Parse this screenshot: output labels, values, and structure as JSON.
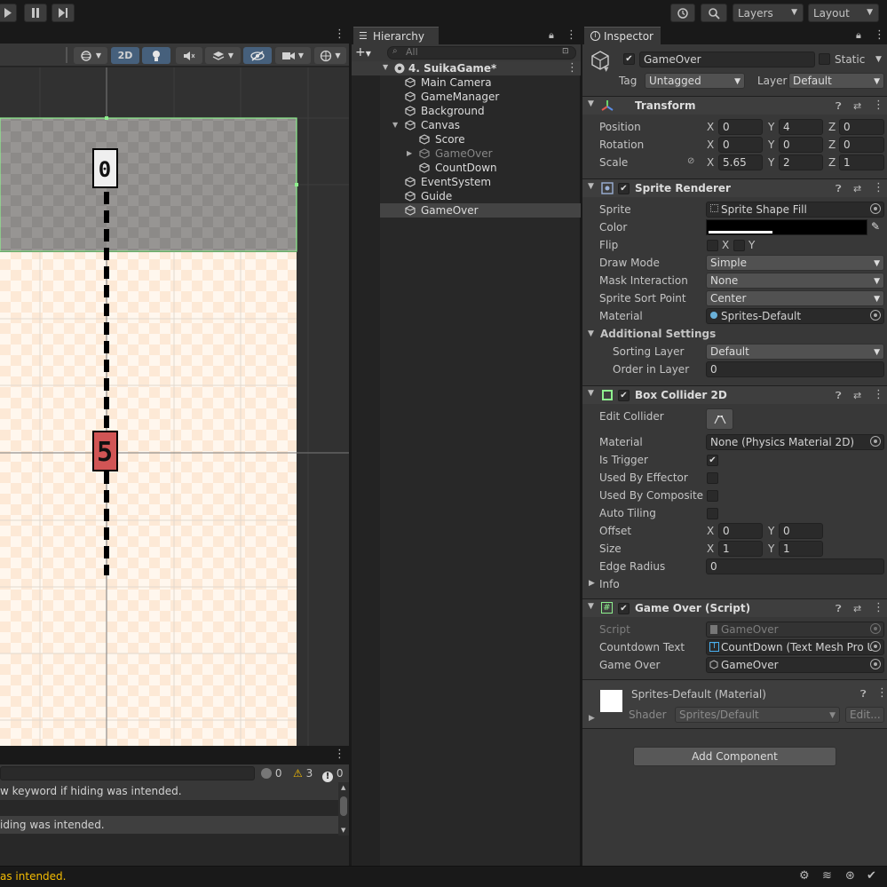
{
  "toolbar": {
    "play_icon": "play-icon",
    "pause_icon": "pause-icon",
    "step_icon": "step-icon",
    "history_icon": "history-icon",
    "search_icon": "search-icon",
    "layers_label": "Layers",
    "layout_label": "Layout"
  },
  "scene": {
    "mode_2d": "2D",
    "digit_top": "0",
    "digit_mid": "5"
  },
  "console": {
    "count_info": "0",
    "count_warn": "3",
    "count_error": "0",
    "line1": "w keyword if hiding was intended.",
    "line2": "iding was intended."
  },
  "hierarchy": {
    "tab_label": "Hierarchy",
    "search_placeholder": "All",
    "scene_name": "4. SuikaGame*",
    "items": [
      {
        "label": "Main Camera"
      },
      {
        "label": "GameManager"
      },
      {
        "label": "Background"
      },
      {
        "label": "Canvas"
      },
      {
        "label": "Score"
      },
      {
        "label": "GameOver"
      },
      {
        "label": "CountDown"
      },
      {
        "label": "EventSystem"
      },
      {
        "label": "Guide"
      },
      {
        "label": "GameOver"
      }
    ]
  },
  "inspector": {
    "tab_label": "Inspector",
    "object_name": "GameOver",
    "static_label": "Static",
    "tag_label": "Tag",
    "tag_value": "Untagged",
    "layer_label": "Layer",
    "layer_value": "Default",
    "transform": {
      "title": "Transform",
      "position_label": "Position",
      "rotation_label": "Rotation",
      "scale_label": "Scale",
      "px": "0",
      "py": "4",
      "pz": "0",
      "rx": "0",
      "ry": "0",
      "rz": "0",
      "sx": "5.65",
      "sy": "2",
      "sz": "1"
    },
    "sprite_renderer": {
      "title": "Sprite Renderer",
      "sprite_label": "Sprite",
      "sprite_value": "Sprite Shape Fill",
      "color_label": "Color",
      "flip_label": "Flip",
      "flip_x": "X",
      "flip_y": "Y",
      "draw_mode_label": "Draw Mode",
      "draw_mode_value": "Simple",
      "mask_label": "Mask Interaction",
      "mask_value": "None",
      "sort_point_label": "Sprite Sort Point",
      "sort_point_value": "Center",
      "material_label": "Material",
      "material_value": "Sprites-Default",
      "additional_label": "Additional Settings",
      "sorting_layer_label": "Sorting Layer",
      "sorting_layer_value": "Default",
      "order_label": "Order in Layer",
      "order_value": "0"
    },
    "box_collider": {
      "title": "Box Collider 2D",
      "edit_label": "Edit Collider",
      "material_label": "Material",
      "material_value": "None (Physics Material 2D)",
      "trigger_label": "Is Trigger",
      "effector_label": "Used By Effector",
      "composite_label": "Used By Composite",
      "tiling_label": "Auto Tiling",
      "offset_label": "Offset",
      "ox": "0",
      "oy": "0",
      "size_label": "Size",
      "szx": "1",
      "szy": "1",
      "edge_label": "Edge Radius",
      "edge_value": "0",
      "info_label": "Info"
    },
    "script_comp": {
      "title": "Game Over (Script)",
      "script_label": "Script",
      "script_value": "GameOver",
      "countdown_label": "Countdown Text",
      "countdown_value": "CountDown (Text Mesh Pro U",
      "gameover_label": "Game Over",
      "gameover_value": "GameOver"
    },
    "material_block": {
      "name": "Sprites-Default (Material)",
      "shader_label": "Shader",
      "shader_value": "Sprites/Default",
      "edit_label": "Edit..."
    },
    "add_component": "Add Component"
  },
  "status": {
    "message": "as intended."
  },
  "colors": {
    "accent": "#46607c",
    "warning_text": "#f4bc02",
    "selected_row": "#2c5d87"
  }
}
